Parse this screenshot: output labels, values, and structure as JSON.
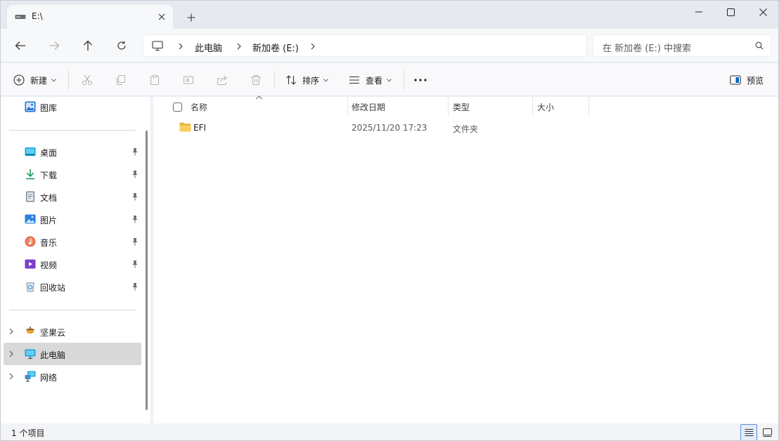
{
  "tab": {
    "title": "E:\\",
    "icon": "drive-icon"
  },
  "window": {
    "controls": [
      "minimize-icon",
      "maximize-icon",
      "close-icon"
    ]
  },
  "breadcrumb": {
    "items": [
      "此电脑",
      "新加卷 (E:)"
    ]
  },
  "search": {
    "placeholder": "在 新加卷 (E:) 中搜索"
  },
  "toolbar": {
    "new_label": "新建",
    "sort_label": "排序",
    "view_label": "查看",
    "preview_label": "预览"
  },
  "sidebar": {
    "top": {
      "label": "图库",
      "icon": "gallery-icon"
    },
    "pinned": [
      {
        "label": "桌面",
        "icon": "desktop-icon"
      },
      {
        "label": "下载",
        "icon": "download-icon"
      },
      {
        "label": "文档",
        "icon": "document-icon"
      },
      {
        "label": "图片",
        "icon": "pictures-icon"
      },
      {
        "label": "音乐",
        "icon": "music-icon"
      },
      {
        "label": "视频",
        "icon": "video-icon"
      },
      {
        "label": "回收站",
        "icon": "recycle-bin-icon"
      }
    ],
    "tree": [
      {
        "label": "坚果云",
        "icon": "nutstore-icon"
      },
      {
        "label": "此电脑",
        "icon": "this-pc-icon",
        "selected": true
      },
      {
        "label": "网络",
        "icon": "network-icon"
      }
    ]
  },
  "columns": {
    "name": "名称",
    "modified": "修改日期",
    "type": "类型",
    "size": "大小"
  },
  "files": [
    {
      "name": "EFI",
      "modified": "2025/11/20 17:23",
      "type": "文件夹",
      "size": "",
      "icon": "folder-icon"
    }
  ],
  "status": {
    "count": "1 个项目"
  },
  "colors": {
    "accent": "#0067c0",
    "folder": "#f2c14e",
    "selected": "#d9d9d9"
  }
}
